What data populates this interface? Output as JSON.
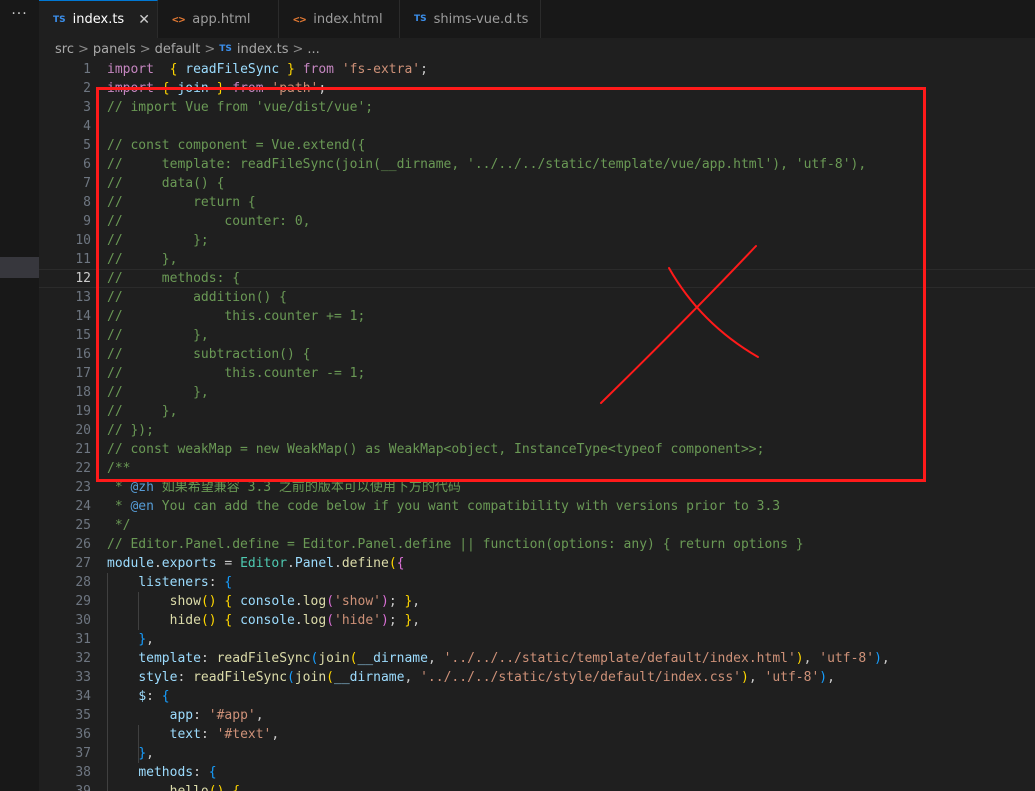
{
  "activity": {
    "more_label": "···"
  },
  "tabs": [
    {
      "label": "index.ts",
      "icon": "TS",
      "active": true,
      "close": "✕"
    },
    {
      "label": "app.html",
      "icon": "<>"
    },
    {
      "label": "index.html",
      "icon": "<>"
    },
    {
      "label": "shims-vue.d.ts",
      "icon": "TS"
    }
  ],
  "breadcrumb": {
    "segments": [
      "src",
      "panels",
      "default"
    ],
    "file_icon": "TS",
    "file": "index.ts",
    "separator": ">",
    "trailing": "..."
  },
  "editor": {
    "active_line": 12,
    "lines": [
      [
        [
          "kw",
          "import"
        ],
        [
          "",
          "  "
        ],
        [
          "brk",
          "{"
        ],
        [
          "",
          " "
        ],
        [
          "var",
          "readFileSync"
        ],
        [
          "",
          " "
        ],
        [
          "brk",
          "}"
        ],
        [
          "",
          " "
        ],
        [
          "kw",
          "from"
        ],
        [
          "",
          " "
        ],
        [
          "str",
          "'fs-extra'"
        ],
        [
          "",
          ";"
        ]
      ],
      [
        [
          "kw",
          "import"
        ],
        [
          "",
          " "
        ],
        [
          "brk",
          "{"
        ],
        [
          "",
          " "
        ],
        [
          "var",
          "join"
        ],
        [
          "",
          " "
        ],
        [
          "brk",
          "}"
        ],
        [
          "",
          " "
        ],
        [
          "kw",
          "from"
        ],
        [
          "",
          " "
        ],
        [
          "str",
          "'path'"
        ],
        [
          "",
          ";"
        ]
      ],
      [
        [
          "cm",
          "// import Vue from 'vue/dist/vue';"
        ]
      ],
      [],
      [
        [
          "cm",
          "// const component = Vue.extend({"
        ]
      ],
      [
        [
          "cm",
          "//     template: readFileSync(join(__dirname, '../../../static/template/vue/app.html'), 'utf-8'),"
        ]
      ],
      [
        [
          "cm",
          "//     data() {"
        ]
      ],
      [
        [
          "cm",
          "//         return {"
        ]
      ],
      [
        [
          "cm",
          "//             counter: 0,"
        ]
      ],
      [
        [
          "cm",
          "//         };"
        ]
      ],
      [
        [
          "cm",
          "//     },"
        ]
      ],
      [
        [
          "cm",
          "//     methods: {"
        ]
      ],
      [
        [
          "cm",
          "//         addition() {"
        ]
      ],
      [
        [
          "cm",
          "//             this.counter += 1;"
        ]
      ],
      [
        [
          "cm",
          "//         },"
        ]
      ],
      [
        [
          "cm",
          "//         subtraction() {"
        ]
      ],
      [
        [
          "cm",
          "//             this.counter -= 1;"
        ]
      ],
      [
        [
          "cm",
          "//         },"
        ]
      ],
      [
        [
          "cm",
          "//     },"
        ]
      ],
      [
        [
          "cm",
          "// });"
        ]
      ],
      [
        [
          "cm",
          "// const weakMap = new WeakMap() as WeakMap<object, InstanceType<typeof component>>;"
        ]
      ],
      [
        [
          "cm",
          "/**"
        ]
      ],
      [
        [
          "cm",
          " * "
        ],
        [
          "cmkw",
          "@zh"
        ],
        [
          "cm",
          " 如果希望兼容 3.3 之前的版本可以使用下方的代码"
        ]
      ],
      [
        [
          "cm",
          " * "
        ],
        [
          "cmkw",
          "@en"
        ],
        [
          "cm",
          " You can add the code below if you want compatibility with versions prior to 3.3"
        ]
      ],
      [
        [
          "cm",
          " */"
        ]
      ],
      [
        [
          "cm",
          "// Editor.Panel.define = Editor.Panel.define || function(options: any) { return options }"
        ]
      ],
      [
        [
          "var",
          "module"
        ],
        [
          "",
          "."
        ],
        [
          "var",
          "exports"
        ],
        [
          "",
          " = "
        ],
        [
          "type",
          "Editor"
        ],
        [
          "",
          "."
        ],
        [
          "var",
          "Panel"
        ],
        [
          "",
          "."
        ],
        [
          "fn",
          "define"
        ],
        [
          "brk",
          "("
        ],
        [
          "brk2",
          "{"
        ]
      ],
      [
        [
          "",
          "    "
        ],
        [
          "var",
          "listeners"
        ],
        [
          "",
          ": "
        ],
        [
          "brk3",
          "{"
        ]
      ],
      [
        [
          "",
          "        "
        ],
        [
          "fn",
          "show"
        ],
        [
          "brk",
          "()"
        ],
        [
          "",
          " "
        ],
        [
          "brk",
          "{"
        ],
        [
          "",
          " "
        ],
        [
          "var",
          "console"
        ],
        [
          "",
          "."
        ],
        [
          "fn",
          "log"
        ],
        [
          "brk2",
          "("
        ],
        [
          "str",
          "'show'"
        ],
        [
          "brk2",
          ")"
        ],
        [
          "",
          "; "
        ],
        [
          "brk",
          "}"
        ],
        [
          "",
          ","
        ]
      ],
      [
        [
          "",
          "        "
        ],
        [
          "fn",
          "hide"
        ],
        [
          "brk",
          "()"
        ],
        [
          "",
          " "
        ],
        [
          "brk",
          "{"
        ],
        [
          "",
          " "
        ],
        [
          "var",
          "console"
        ],
        [
          "",
          "."
        ],
        [
          "fn",
          "log"
        ],
        [
          "brk2",
          "("
        ],
        [
          "str",
          "'hide'"
        ],
        [
          "brk2",
          ")"
        ],
        [
          "",
          "; "
        ],
        [
          "brk",
          "}"
        ],
        [
          "",
          ","
        ]
      ],
      [
        [
          "",
          "    "
        ],
        [
          "brk3",
          "}"
        ],
        [
          "",
          ","
        ]
      ],
      [
        [
          "",
          "    "
        ],
        [
          "var",
          "template"
        ],
        [
          "",
          ": "
        ],
        [
          "fn",
          "readFileSync"
        ],
        [
          "brk3",
          "("
        ],
        [
          "fn",
          "join"
        ],
        [
          "brk",
          "("
        ],
        [
          "var",
          "__dirname"
        ],
        [
          "",
          ", "
        ],
        [
          "str",
          "'../../../static/template/default/index.html'"
        ],
        [
          "brk",
          ")"
        ],
        [
          "",
          ", "
        ],
        [
          "str",
          "'utf-8'"
        ],
        [
          "brk3",
          ")"
        ],
        [
          "",
          ","
        ]
      ],
      [
        [
          "",
          "    "
        ],
        [
          "var",
          "style"
        ],
        [
          "",
          ": "
        ],
        [
          "fn",
          "readFileSync"
        ],
        [
          "brk3",
          "("
        ],
        [
          "fn",
          "join"
        ],
        [
          "brk",
          "("
        ],
        [
          "var",
          "__dirname"
        ],
        [
          "",
          ", "
        ],
        [
          "str",
          "'../../../static/style/default/index.css'"
        ],
        [
          "brk",
          ")"
        ],
        [
          "",
          ", "
        ],
        [
          "str",
          "'utf-8'"
        ],
        [
          "brk3",
          ")"
        ],
        [
          "",
          ","
        ]
      ],
      [
        [
          "",
          "    "
        ],
        [
          "var",
          "$"
        ],
        [
          "",
          ": "
        ],
        [
          "brk3",
          "{"
        ]
      ],
      [
        [
          "",
          "        "
        ],
        [
          "var",
          "app"
        ],
        [
          "",
          ": "
        ],
        [
          "str",
          "'#app'"
        ],
        [
          "",
          ","
        ]
      ],
      [
        [
          "",
          "        "
        ],
        [
          "var",
          "text"
        ],
        [
          "",
          ": "
        ],
        [
          "str",
          "'#text'"
        ],
        [
          "",
          ","
        ]
      ],
      [
        [
          "",
          "    "
        ],
        [
          "brk3",
          "}"
        ],
        [
          "",
          ","
        ]
      ],
      [
        [
          "",
          "    "
        ],
        [
          "var",
          "methods"
        ],
        [
          "",
          ": "
        ],
        [
          "brk3",
          "{"
        ]
      ],
      [
        [
          "",
          "        "
        ],
        [
          "fn",
          "hello"
        ],
        [
          "brk",
          "()"
        ],
        [
          "",
          " "
        ],
        [
          "brk",
          "{"
        ]
      ]
    ]
  }
}
